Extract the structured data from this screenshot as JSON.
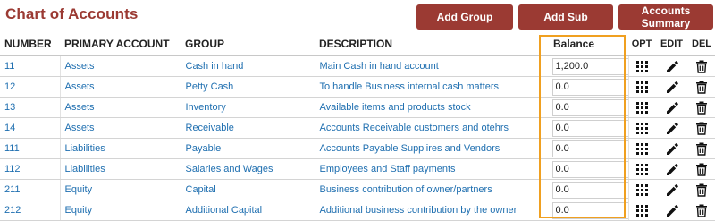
{
  "page_title": "Chart of Accounts",
  "buttons": {
    "add_group": "Add Group",
    "add_sub": "Add Sub",
    "accounts_summary": "Accounts Summary"
  },
  "columns": {
    "number": "NUMBER",
    "primary_account": "PRIMARY ACCOUNT",
    "group": "GROUP",
    "description": "DESCRIPTION",
    "balance": "Balance",
    "opt": "OPT",
    "edit": "EDIT",
    "del": "DEL"
  },
  "rows": [
    {
      "number": "11",
      "primary": "Assets",
      "group": "Cash in hand",
      "description": "Main Cash in hand account",
      "balance": "1,200.0"
    },
    {
      "number": "12",
      "primary": "Assets",
      "group": "Petty Cash",
      "description": "To handle Business internal cash matters",
      "balance": "0.0"
    },
    {
      "number": "13",
      "primary": "Assets",
      "group": "Inventory",
      "description": "Available items and products stock",
      "balance": "0.0"
    },
    {
      "number": "14",
      "primary": "Assets",
      "group": "Receivable",
      "description": "Accounts Receivable customers and otehrs",
      "balance": "0.0"
    },
    {
      "number": "111",
      "primary": "Liabilities",
      "group": "Payable",
      "description": "Accounts Payable Supplires and Vendors",
      "balance": "0.0"
    },
    {
      "number": "112",
      "primary": "Liabilities",
      "group": "Salaries and Wages",
      "description": "Employees and Staff payments",
      "balance": "0.0"
    },
    {
      "number": "211",
      "primary": "Equity",
      "group": "Capital",
      "description": "Business contribution of owner/partners",
      "balance": "0.0"
    },
    {
      "number": "212",
      "primary": "Equity",
      "group": "Additional Capital",
      "description": "Additional business contribution by the owner",
      "balance": "0.0"
    }
  ],
  "row_icons": {
    "opt": "grid-dots-icon",
    "edit": "pencil-icon",
    "del": "trash-icon"
  },
  "colors": {
    "brand": "#9b3a33",
    "link": "#1f6fb0",
    "highlight": "#f0a020"
  }
}
